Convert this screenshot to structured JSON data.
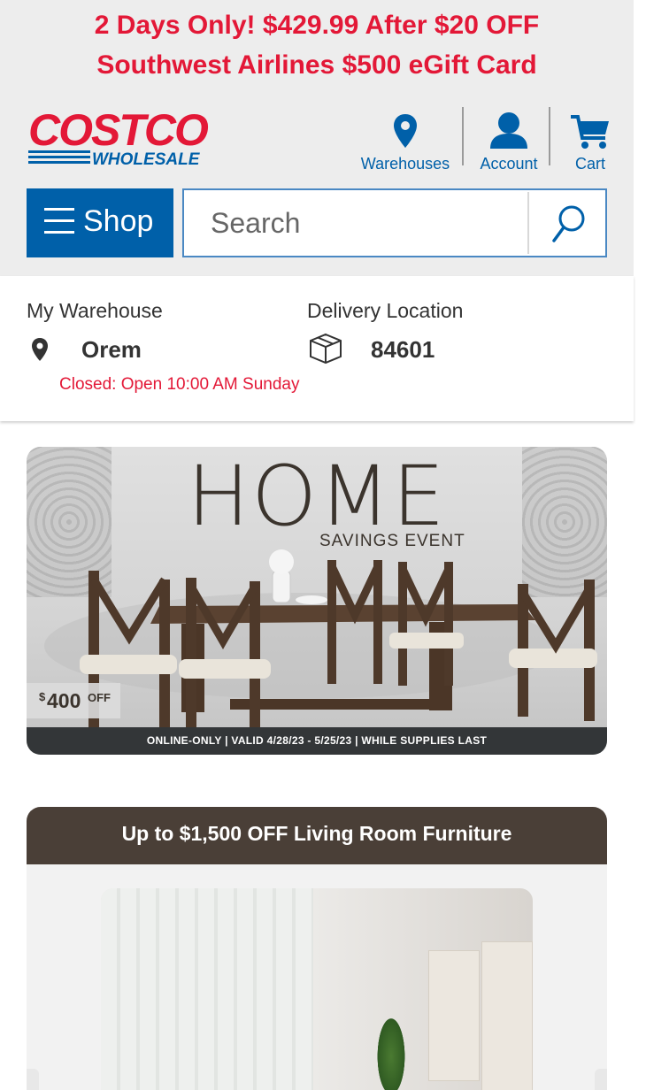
{
  "promo": {
    "line1": "2 Days Only! $429.99 After $20 OFF",
    "line2": "Southwest Airlines $500 eGift Card"
  },
  "logo": {
    "top": "COSTCO",
    "bottom": "WHOLESALE"
  },
  "nav": {
    "warehouses": "Warehouses",
    "account": "Account",
    "cart": "Cart"
  },
  "shop": {
    "label": "Shop"
  },
  "search": {
    "placeholder": "Search"
  },
  "location": {
    "warehouse_label": "My Warehouse",
    "warehouse_name": "Orem",
    "warehouse_status": "Closed: Open 10:00 AM Sunday",
    "delivery_label": "Delivery Location",
    "delivery_zip": "84601"
  },
  "banner_home": {
    "title": "HOME",
    "subtitle": "SAVINGS EVENT",
    "badge_currency": "$",
    "badge_amount": "400",
    "badge_off": "OFF",
    "footer": "ONLINE-ONLY | VALID 4/28/23 - 5/25/23 | WHILE SUPPLIES LAST"
  },
  "banner_living": {
    "heading": "Up to $1,500 OFF Living Room Furniture"
  },
  "colors": {
    "brand_red": "#e31837",
    "brand_blue": "#0060a9",
    "banner_brown": "#4a3f37"
  }
}
